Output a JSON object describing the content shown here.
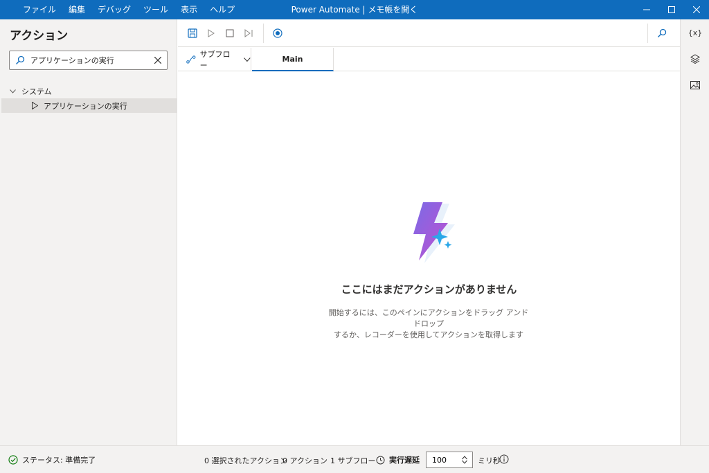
{
  "window": {
    "title": "Power Automate | メモ帳を開く",
    "menu": [
      "ファイル",
      "編集",
      "デバッグ",
      "ツール",
      "表示",
      "ヘルプ"
    ]
  },
  "actions_panel": {
    "title": "アクション",
    "search": {
      "value": "アプリケーションの実行",
      "placeholder": ""
    },
    "tree": {
      "group": "システム",
      "item": "アプリケーションの実行"
    }
  },
  "tabs": {
    "subflow_label": "サブフロー",
    "main_label": "Main"
  },
  "canvas": {
    "empty_title": "ここにはまだアクションがありません",
    "empty_desc_line1": "開始するには、このペインにアクションをドラッグ アンド ドロップ",
    "empty_desc_line2": "するか、レコーダーを使用してアクションを取得します"
  },
  "right_rail": {
    "variables_label": "{x}"
  },
  "statusbar": {
    "status": "ステータス: 準備完了",
    "selected_actions": "0 選択されたアクション",
    "actions": "0 アクション",
    "subflows": "1 サブフロー",
    "delay_label": "実行遅延",
    "delay_value": "100",
    "delay_unit": "ミリ秒"
  },
  "colors": {
    "accent": "#0f6cbd",
    "panel_bg": "#f3f2f1",
    "status_ok": "#107c10"
  },
  "icons": [
    "search-icon",
    "close-icon",
    "chevron-down-icon",
    "play-icon",
    "save-icon",
    "run-icon",
    "stop-icon",
    "step-icon",
    "record-icon",
    "subflow-icon",
    "layers-icon",
    "image-icon",
    "check-circle-icon",
    "clock-icon",
    "info-icon",
    "minimize-icon",
    "maximize-icon"
  ]
}
